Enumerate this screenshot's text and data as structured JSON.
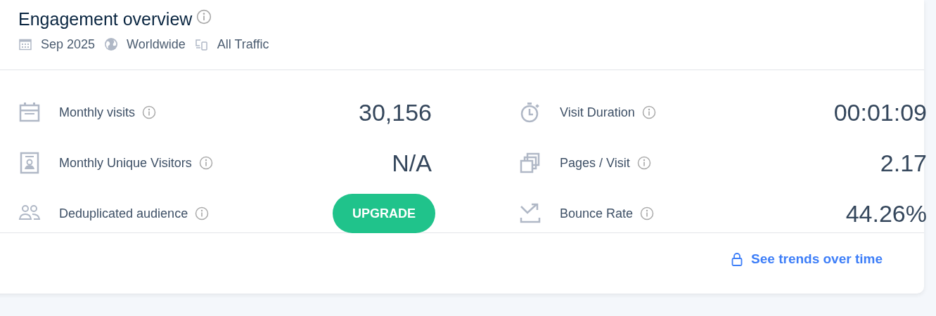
{
  "header": {
    "title": "Engagement overview",
    "filters": [
      {
        "kind": "date",
        "label": "Sep 2025"
      },
      {
        "kind": "region",
        "label": "Worldwide"
      },
      {
        "kind": "traffic",
        "label": "All Traffic"
      }
    ]
  },
  "metrics": [
    {
      "kind": "value",
      "label": "Monthly visits",
      "value": "30,156"
    },
    {
      "kind": "value",
      "label": "Visit Duration",
      "value": "00:01:09"
    },
    {
      "kind": "value",
      "label": "Monthly Unique Visitors",
      "value": "N/A"
    },
    {
      "kind": "value",
      "label": "Pages / Visit",
      "value": "2.17"
    },
    {
      "kind": "upgrade",
      "label": "Deduplicated audience",
      "value": "UPGRADE"
    },
    {
      "kind": "value",
      "label": "Bounce Rate",
      "value": "44.26%"
    }
  ],
  "footer": {
    "link": "See trends over time"
  }
}
